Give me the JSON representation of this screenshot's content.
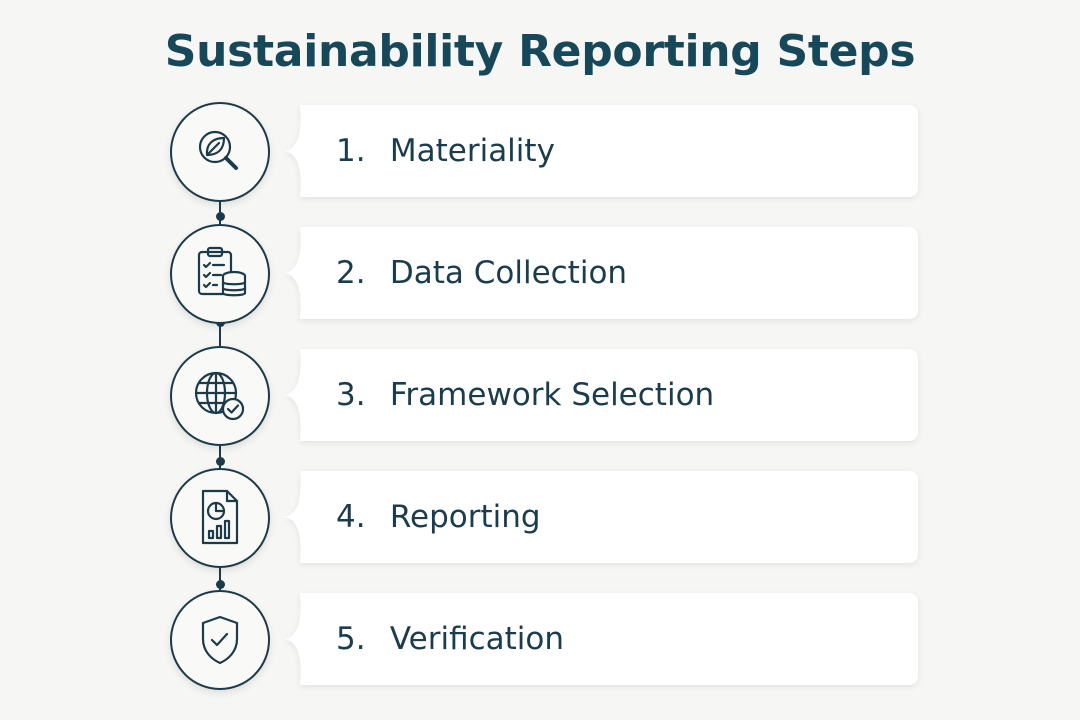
{
  "title": "Sustainability Reporting Steps",
  "steps": [
    {
      "number": "1.",
      "label": "Materiality",
      "icon": "leaf-magnifier-icon"
    },
    {
      "number": "2.",
      "label": "Data Collection",
      "icon": "clipboard-database-icon"
    },
    {
      "number": "3.",
      "label": "Framework Selection",
      "icon": "globe-check-icon"
    },
    {
      "number": "4.",
      "label": "Reporting",
      "icon": "report-document-icon"
    },
    {
      "number": "5.",
      "label": "Verification",
      "icon": "shield-check-icon"
    }
  ],
  "colors": {
    "title": "#17485a",
    "line": "#1c3b4a",
    "text": "#1a3c4c",
    "card": "#ffffff",
    "background": "#f6f6f4"
  }
}
